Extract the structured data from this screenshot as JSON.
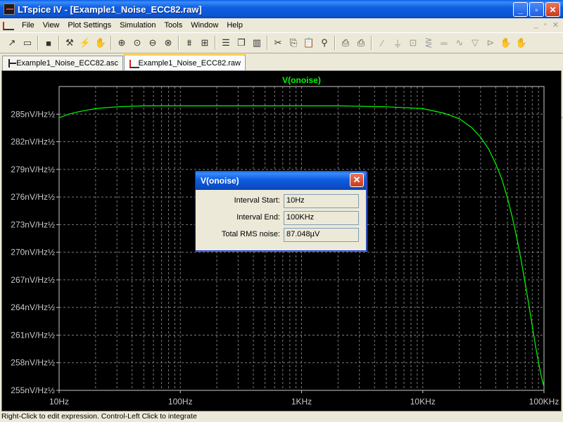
{
  "window": {
    "title": "LTspice IV - [Example1_Noise_ECC82.raw]",
    "minimize_label": "_",
    "maximize_label": "▫",
    "close_label": "✕"
  },
  "menu": {
    "items": [
      "File",
      "View",
      "Plot Settings",
      "Simulation",
      "Tools",
      "Window",
      "Help"
    ]
  },
  "toolbar": {
    "icons": [
      "open-icon",
      "open-folder-icon",
      "save-icon",
      "control-panel-icon",
      "run-icon",
      "halt-icon",
      "zoom-in-icon",
      "zoom-back-icon",
      "zoom-out-icon",
      "zoom-cancel-icon",
      "autorange-icon",
      "fit-icon",
      "tile-horizontal-icon",
      "cascade-icon",
      "tile-vertical-icon",
      "cut-icon",
      "copy-icon",
      "paste-icon",
      "find-icon",
      "print-preview-icon",
      "print-icon",
      "wire-icon",
      "ground-icon",
      "label-icon",
      "resistor-icon",
      "capacitor-icon",
      "inductor-icon",
      "diode-icon",
      "component-icon",
      "move-icon",
      "drag-icon"
    ]
  },
  "tabs": [
    {
      "label": "Example1_Noise_ECC82.asc",
      "active": false
    },
    {
      "label": "Example1_Noise_ECC82.raw",
      "active": true
    }
  ],
  "chart_data": {
    "type": "line",
    "title": "V(onoise)",
    "x_scale": "log",
    "xlim": [
      10,
      100000
    ],
    "x_ticks": [
      "10Hz",
      "100Hz",
      "1KHz",
      "10KHz",
      "100KHz"
    ],
    "ylim": [
      255,
      288
    ],
    "y_ticks": [
      "285nV/Hz½",
      "282nV/Hz½",
      "279nV/Hz½",
      "276nV/Hz½",
      "273nV/Hz½",
      "270nV/Hz½",
      "267nV/Hz½",
      "264nV/Hz½",
      "261nV/Hz½",
      "258nV/Hz½",
      "255nV/Hz½"
    ],
    "y_tick_values": [
      285,
      282,
      279,
      276,
      273,
      270,
      267,
      264,
      261,
      258,
      255
    ],
    "grid": true,
    "series": [
      {
        "name": "V(onoise)",
        "color": "#00ff00",
        "x": [
          10,
          12,
          15,
          20,
          30,
          50,
          100,
          200,
          500,
          1000,
          2000,
          5000,
          10000,
          15000,
          20000,
          25000,
          30000,
          35000,
          40000,
          45000,
          50000,
          55000,
          60000,
          65000,
          70000,
          75000,
          80000,
          85000,
          90000,
          95000,
          100000
        ],
        "y": [
          284.6,
          285.0,
          285.3,
          285.6,
          285.8,
          285.9,
          285.9,
          285.9,
          285.9,
          285.9,
          285.9,
          285.8,
          285.6,
          285.1,
          284.5,
          283.6,
          282.5,
          281.2,
          279.6,
          277.9,
          275.9,
          273.7,
          271.4,
          269.0,
          266.6,
          264.3,
          262.0,
          259.9,
          258.1,
          256.5,
          255.4
        ]
      }
    ]
  },
  "dialog": {
    "title": "V(onoise)",
    "close_label": "✕",
    "interval_start_label": "Interval Start:",
    "interval_start_value": "10Hz",
    "interval_end_label": "Interval End:",
    "interval_end_value": "100KHz",
    "total_rms_label": "Total RMS noise:",
    "total_rms_value": "87.048µV"
  },
  "status": {
    "text": "Right-Click to edit expression.  Control-Left Click to integrate"
  }
}
